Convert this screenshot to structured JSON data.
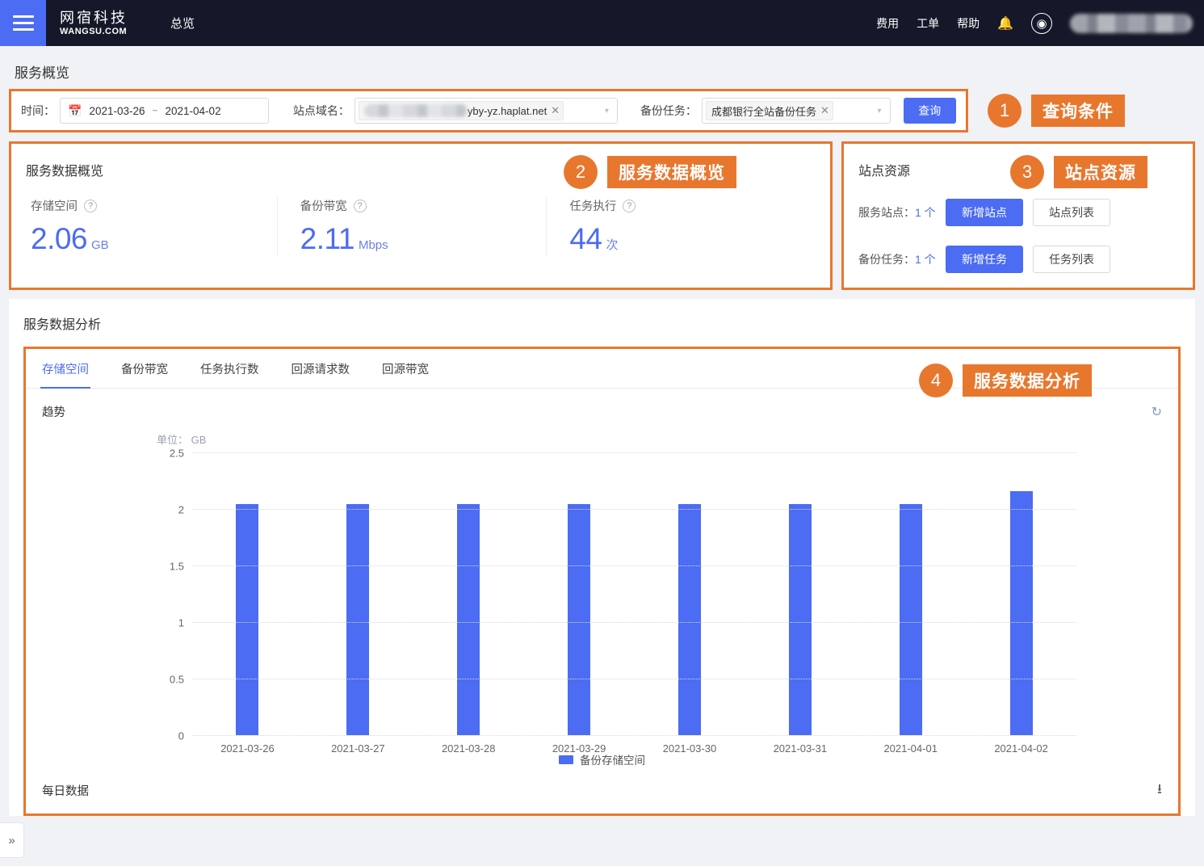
{
  "topnav": {
    "menu_icon": "hamburger-icon",
    "brand_cn": "网宿科技",
    "brand_en": "WANGSU.COM",
    "overview": "总览",
    "links": [
      "费用",
      "工单",
      "帮助"
    ],
    "bell_icon": "bell-icon",
    "avatar_icon": "user-avatar-icon"
  },
  "page": {
    "title": "服务概览"
  },
  "filter": {
    "time_label": "时间：",
    "calendar_icon": "calendar-icon",
    "date_start": "2021-03-26",
    "date_sep": "~",
    "date_end": "2021-04-02",
    "domain_label": "站点域名：",
    "domain_value": "yby-yz.haplat.net",
    "domain_clear": "✕",
    "task_label": "备份任务：",
    "task_value": "成都银行全站备份任务",
    "task_clear": "✕",
    "query_button": "查询",
    "caret_icon": "chevron-down-icon"
  },
  "markers": [
    {
      "num": "1",
      "text": "查询条件"
    },
    {
      "num": "2",
      "text": "服务数据概览"
    },
    {
      "num": "3",
      "text": "站点资源"
    },
    {
      "num": "4",
      "text": "服务数据分析"
    }
  ],
  "overview": {
    "title": "服务数据概览",
    "metrics": [
      {
        "label": "存储空间",
        "help": "?",
        "value": "2.06",
        "unit": "GB"
      },
      {
        "label": "备份带宽",
        "help": "?",
        "value": "2.11",
        "unit": "Mbps"
      },
      {
        "label": "任务执行",
        "help": "?",
        "value": "44",
        "unit": "次"
      }
    ]
  },
  "resources": {
    "title": "站点资源",
    "rows": [
      {
        "label": "服务站点：",
        "count": "1 个",
        "primary": "新增站点",
        "secondary": "站点列表"
      },
      {
        "label": "备份任务：",
        "count": "1 个",
        "primary": "新增任务",
        "secondary": "任务列表"
      }
    ]
  },
  "analysis": {
    "title": "服务数据分析",
    "tabs": [
      {
        "label": "存储空间",
        "active": true
      },
      {
        "label": "备份带宽",
        "active": false
      },
      {
        "label": "任务执行数",
        "active": false
      },
      {
        "label": "回源请求数",
        "active": false
      },
      {
        "label": "回源带宽",
        "active": false
      }
    ],
    "trend_title": "趋势",
    "refresh_icon": "refresh-icon",
    "daily_title": "每日数据",
    "download_icon": "download-icon"
  },
  "chart_data": {
    "type": "bar",
    "title": "趋势",
    "unit_label": "单位：",
    "unit": "GB",
    "xlabel": "",
    "ylabel": "GB",
    "ylim": [
      0,
      2.5
    ],
    "yticks": [
      0,
      0.5,
      1,
      1.5,
      2,
      2.5
    ],
    "ytick_labels": [
      "0",
      "0.5",
      "1",
      "1.5",
      "2",
      "2.5"
    ],
    "grid": true,
    "legend_position": "bottom",
    "categories": [
      "2021-03-26",
      "2021-03-27",
      "2021-03-28",
      "2021-03-29",
      "2021-03-30",
      "2021-03-31",
      "2021-04-01",
      "2021-04-02"
    ],
    "series": [
      {
        "name": "备份存储空间",
        "color": "#4b6cf3",
        "values": [
          2.04,
          2.04,
          2.04,
          2.04,
          2.04,
          2.04,
          2.04,
          2.16
        ]
      }
    ]
  },
  "collapse": {
    "icon": "»"
  }
}
